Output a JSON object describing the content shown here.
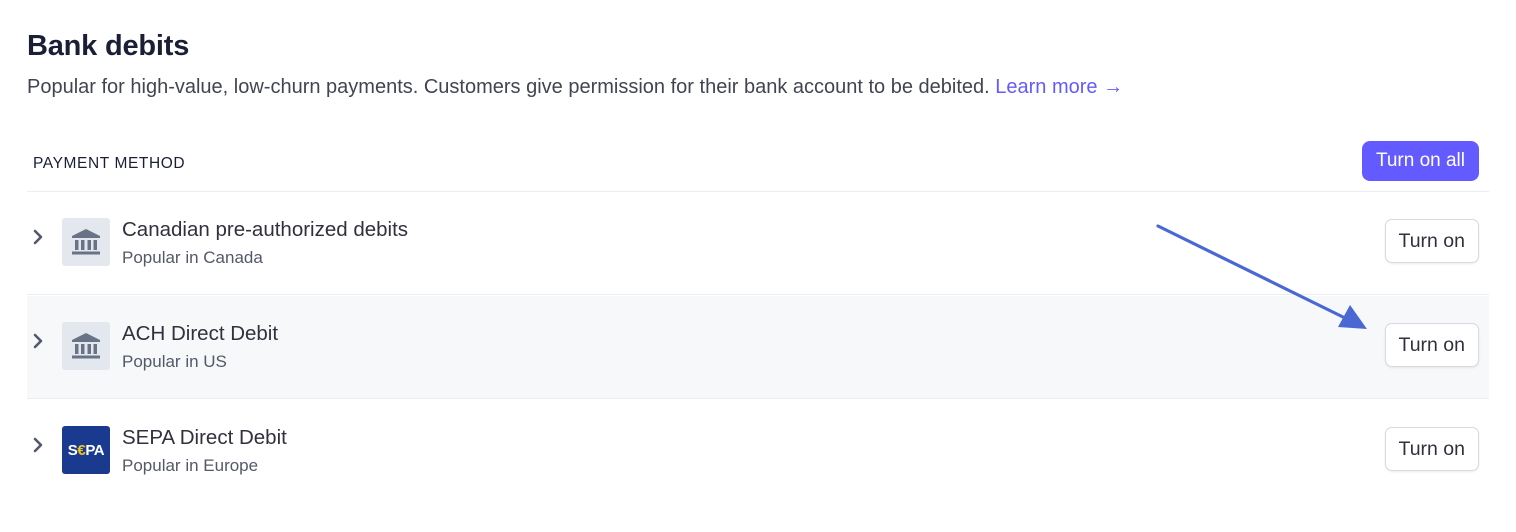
{
  "section": {
    "title": "Bank debits",
    "description": "Popular for high-value, low-churn payments. Customers give permission for their bank account to be debited.",
    "learn_more_label": "Learn more →"
  },
  "table": {
    "column_label": "PAYMENT METHOD",
    "turn_on_all_label": "Turn on all"
  },
  "methods": [
    {
      "name": "Canadian pre-authorized debits",
      "subtitle": "Popular in Canada",
      "icon": "bank-icon",
      "button_label": "Turn on"
    },
    {
      "name": "ACH Direct Debit",
      "subtitle": "Popular in US",
      "icon": "bank-icon",
      "button_label": "Turn on"
    },
    {
      "name": "SEPA Direct Debit",
      "subtitle": "Popular in Europe",
      "icon": "sepa-logo",
      "logo_text_left": "S",
      "logo_text_euro": "€",
      "logo_text_right": "PA",
      "button_label": "Turn on"
    }
  ],
  "colors": {
    "accent": "#635bff",
    "annotation_arrow": "#4a68d3",
    "highlight_row": "#f6f8fa",
    "sepa_blue": "#1a3a8f"
  }
}
